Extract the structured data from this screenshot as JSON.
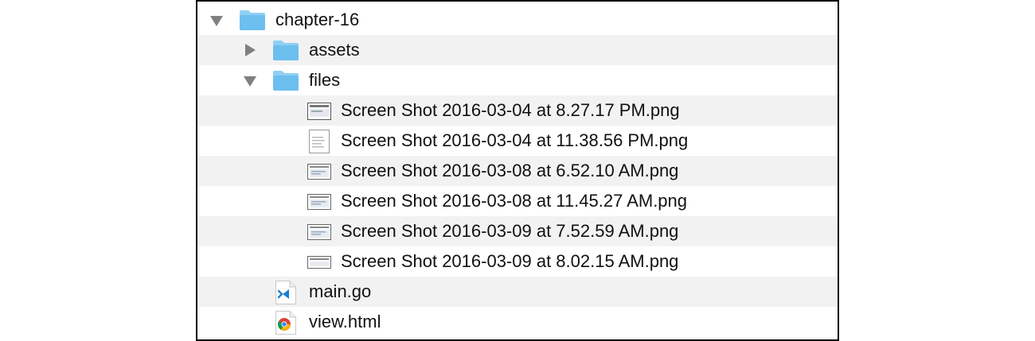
{
  "tree": {
    "root_folder": "chapter-16",
    "assets_folder": "assets",
    "files_folder": "files",
    "screenshots": [
      "Screen Shot 2016-03-04 at 8.27.17 PM.png",
      "Screen Shot 2016-03-04 at 11.38.56 PM.png",
      "Screen Shot 2016-03-08 at 6.52.10 AM.png",
      "Screen Shot 2016-03-08 at 11.45.27 AM.png",
      "Screen Shot 2016-03-09 at 7.52.59 AM.png",
      "Screen Shot 2016-03-09 at 8.02.15 AM.png"
    ],
    "main_file": "main.go",
    "view_file": "view.html"
  },
  "colors": {
    "folder_blue": "#6cbfee",
    "folder_tab": "#8fd0f4",
    "alternate_row": "#f2f2f2",
    "disclosure_gray": "#808080",
    "vscode_blue": "#1f7fd1"
  }
}
